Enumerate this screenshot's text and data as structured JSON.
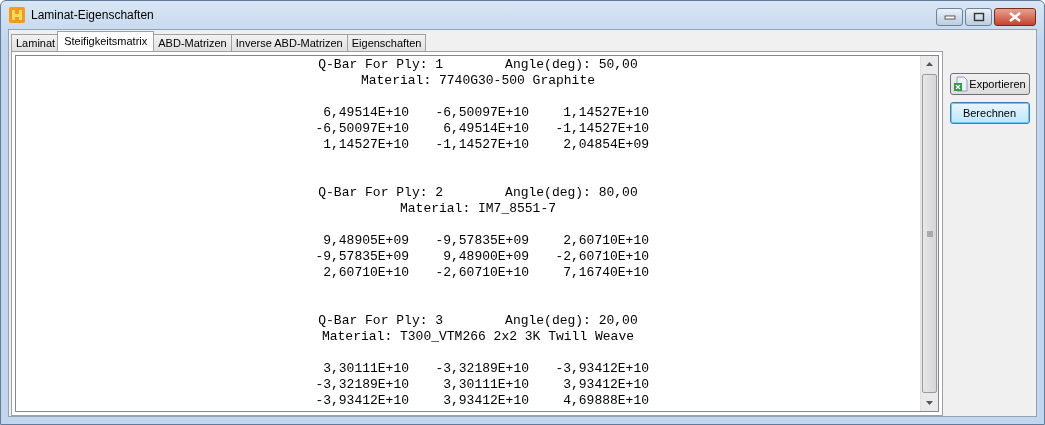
{
  "window": {
    "title": "Laminat-Eigenschaften"
  },
  "tabs": [
    {
      "label": "Laminat",
      "selected": false
    },
    {
      "label": "Steifigkeitsmatrix",
      "selected": true
    },
    {
      "label": "ABD-Matrizen",
      "selected": false
    },
    {
      "label": "Inverse ABD-Matrizen",
      "selected": false
    },
    {
      "label": "Eigenschaften",
      "selected": false
    }
  ],
  "plies": [
    {
      "ply": "Q-Bar For Ply: 1",
      "angle": "Angle(deg): 50,00",
      "material": "Material: 7740G30-500 Graphite",
      "matrix": [
        [
          "6,49514E+10",
          "-6,50097E+10",
          "1,14527E+10"
        ],
        [
          "-6,50097E+10",
          "6,49514E+10",
          "-1,14527E+10"
        ],
        [
          "1,14527E+10",
          "-1,14527E+10",
          "2,04854E+09"
        ]
      ]
    },
    {
      "ply": "Q-Bar For Ply: 2",
      "angle": "Angle(deg): 80,00",
      "material": "Material: IM7_8551-7",
      "matrix": [
        [
          "9,48905E+09",
          "-9,57835E+09",
          "2,60710E+10"
        ],
        [
          "-9,57835E+09",
          "9,48900E+09",
          "-2,60710E+10"
        ],
        [
          "2,60710E+10",
          "-2,60710E+10",
          "7,16740E+10"
        ]
      ]
    },
    {
      "ply": "Q-Bar For Ply: 3",
      "angle": "Angle(deg): 20,00",
      "material": "Material: T300_VTM266 2x2 3K Twill Weave",
      "matrix": [
        [
          "3,30111E+10",
          "-3,32189E+10",
          "-3,93412E+10"
        ],
        [
          "-3,32189E+10",
          "3,30111E+10",
          "3,93412E+10"
        ],
        [
          "-3,93412E+10",
          "3,93412E+10",
          "4,69888E+10"
        ]
      ]
    }
  ],
  "buttons": [
    {
      "label": "Exportieren",
      "kind": "export",
      "default": false
    },
    {
      "label": "Berechnen",
      "kind": "plain",
      "default": true
    }
  ]
}
